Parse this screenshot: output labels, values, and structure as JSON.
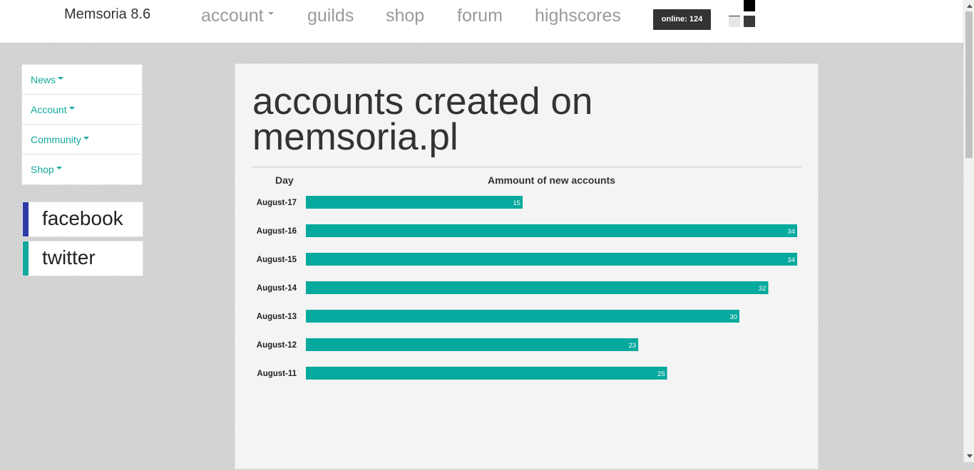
{
  "navbar": {
    "brand": "Memsoria 8.6",
    "links": [
      "account",
      "guilds",
      "shop",
      "forum",
      "highscores"
    ],
    "online_badge": "online: 124"
  },
  "sidebar": {
    "items": [
      {
        "label": "News"
      },
      {
        "label": "Account"
      },
      {
        "label": "Community"
      },
      {
        "label": "Shop"
      }
    ],
    "social": [
      {
        "label": "facebook",
        "color": "#2c3ca8"
      },
      {
        "label": "twitter",
        "color": "#13a89e"
      }
    ]
  },
  "main": {
    "title": "accounts created on memsoria.pl",
    "col_day": "Day",
    "col_amount": "Ammount of new accounts"
  },
  "chart_data": {
    "type": "bar",
    "orientation": "horizontal",
    "categories": [
      "August-17",
      "August-16",
      "August-15",
      "August-14",
      "August-13",
      "August-12",
      "August-11"
    ],
    "values": [
      15,
      34,
      34,
      32,
      30,
      23,
      25
    ],
    "xlabel": "Ammount of new accounts",
    "ylabel": "Day",
    "xlim": [
      0,
      34
    ],
    "bar_color": "#05a99d",
    "grid": false
  },
  "colors": {
    "accent": "#13a89e",
    "badge_bg": "#333333"
  }
}
